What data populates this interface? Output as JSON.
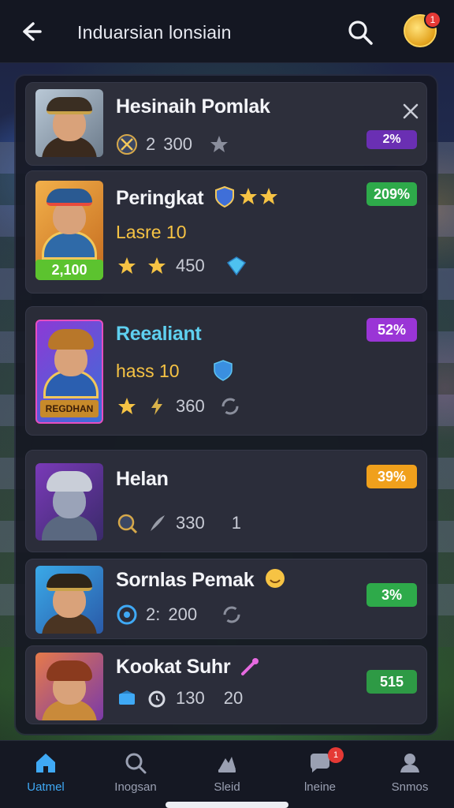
{
  "header": {
    "title": "Induarsian lonsiain",
    "avatar_badge": "1"
  },
  "players": [
    {
      "name": "Hesinaih Pomlak",
      "stats": [
        "2",
        "300"
      ],
      "badge": "2%",
      "badge_color": "#6a2fb3"
    },
    {
      "name": "Peringkat",
      "level": "Lasre 10",
      "stats": [
        "450"
      ],
      "pill": "2,100",
      "badge": "209%",
      "badge_color": "#2eaa4a"
    },
    {
      "name": "Reealiant",
      "level": "hass 10",
      "stats": [
        "360"
      ],
      "portrait_label": "REGDHAN",
      "badge": "52%",
      "badge_color": "#9a35d6"
    },
    {
      "name": "Helan",
      "stats": [
        "330",
        "1"
      ],
      "badge": "39%",
      "badge_color": "#f0a01c"
    },
    {
      "name": "Sornlas Pemak",
      "stats": [
        "2:",
        "200"
      ],
      "badge": "3%",
      "badge_color": "#2eaa4a"
    },
    {
      "name": "Kookat Suhr",
      "stats": [
        "130",
        "20"
      ],
      "badge": "515",
      "badge_color": "#2e9a45"
    }
  ],
  "nav": {
    "items": [
      {
        "label": "Uatmel",
        "icon": "home-icon",
        "active": true
      },
      {
        "label": "Inogsan",
        "icon": "search-icon"
      },
      {
        "label": "Sleid",
        "icon": "battle-icon"
      },
      {
        "label": "lneine",
        "icon": "chat-icon",
        "badge": "1"
      },
      {
        "label": "Snmos",
        "icon": "profile-icon"
      }
    ]
  },
  "colors": {
    "accent": "#3fa9f5",
    "gold": "#f6c344",
    "cyan_name": "#5fd0f0"
  }
}
